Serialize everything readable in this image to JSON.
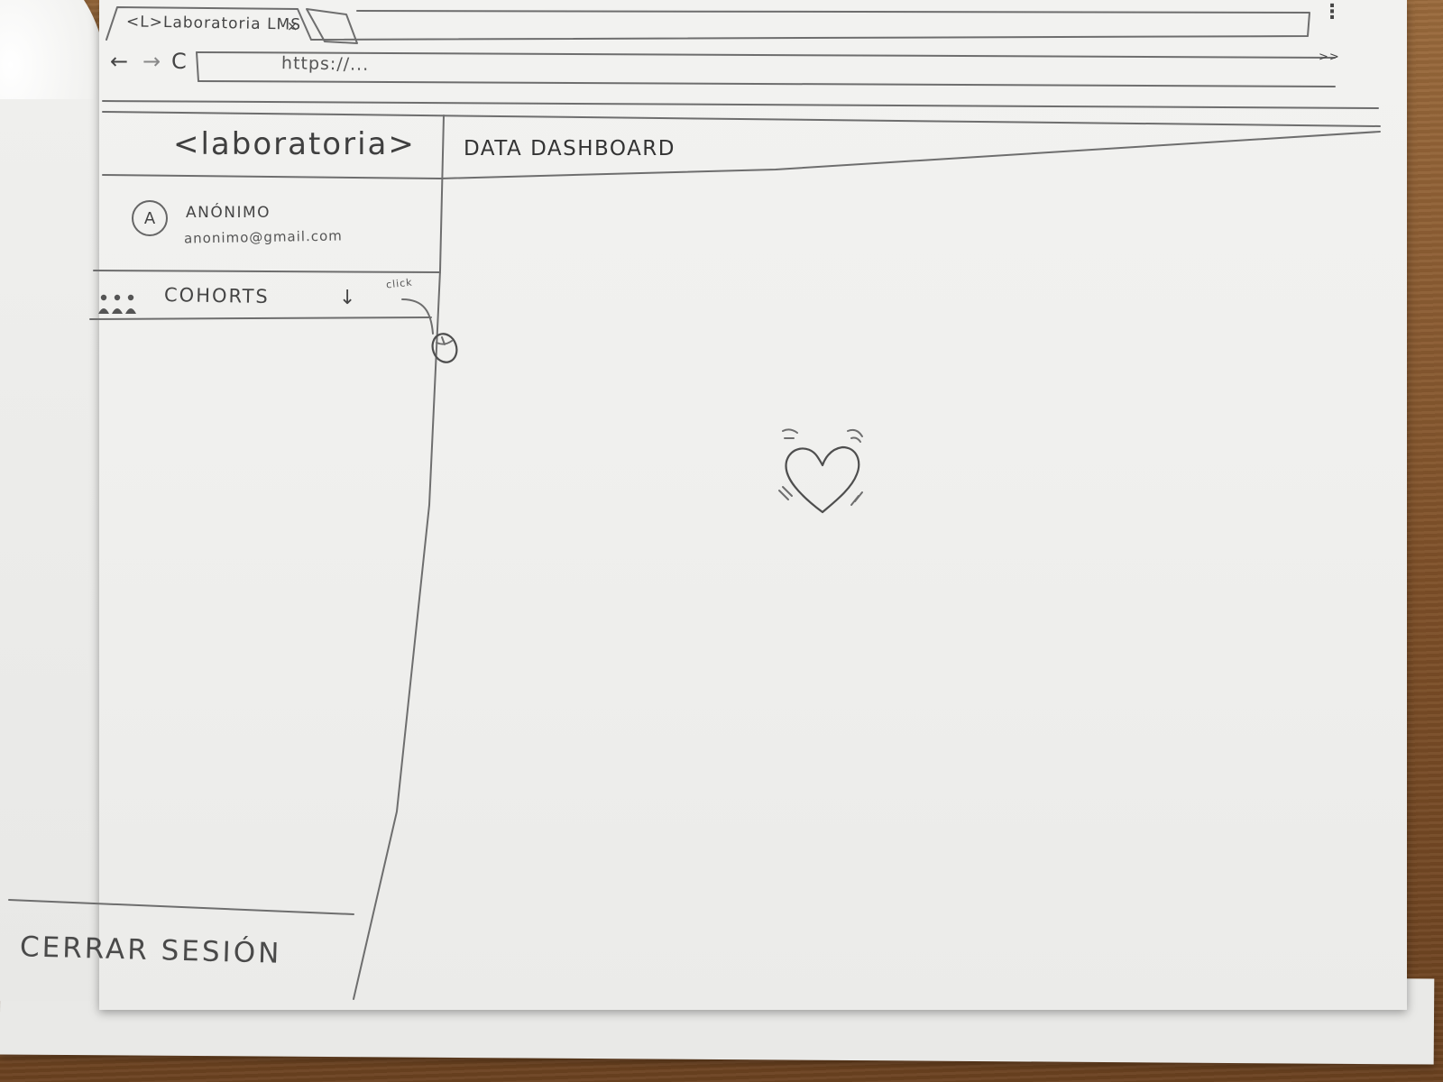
{
  "browser": {
    "tab_title": "<L>Laboratoria LMS",
    "tab_close": "×",
    "url": "https://...",
    "back": "←",
    "forward": "→",
    "reload": "C",
    "menu": "⋮",
    "more": ">>"
  },
  "sidebar": {
    "logo": "<laboratoria>",
    "user": {
      "avatar_letter": "A",
      "name": "ANÓNIMO",
      "email": "anonimo@gmail.com"
    },
    "cohorts": {
      "label": "COHORTS",
      "arrow": "↓",
      "annotation": "click"
    },
    "logout": "CERRAR SESIÓN"
  },
  "main": {
    "title": "DATA DASHBOARD",
    "center_icon": "heart-icon"
  }
}
